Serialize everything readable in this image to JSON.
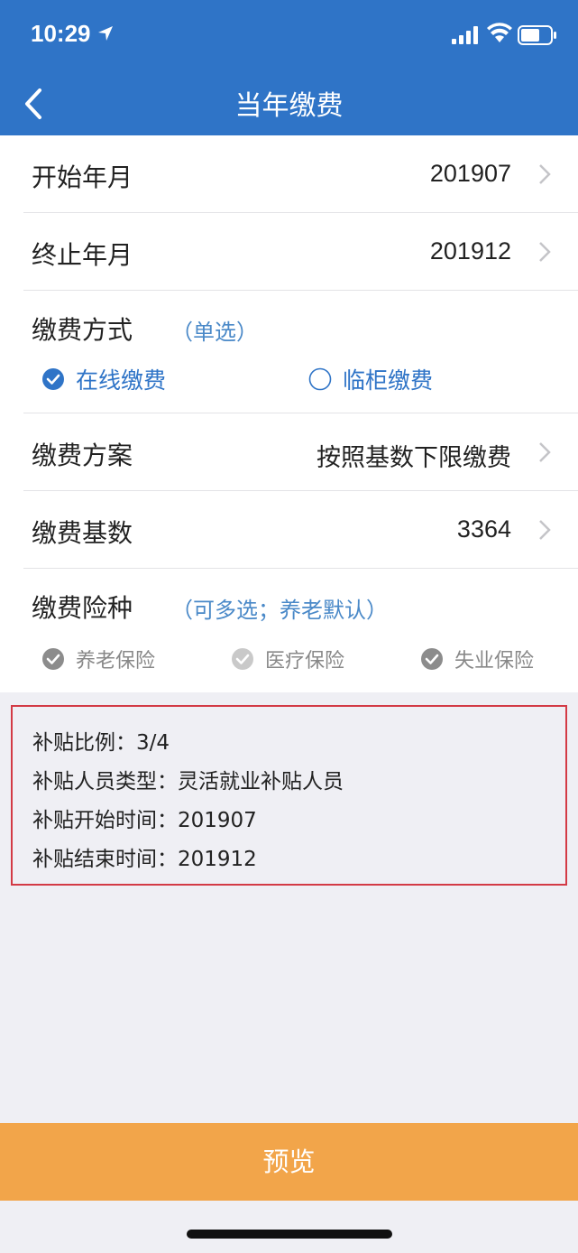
{
  "status_bar": {
    "time": "10:29"
  },
  "header": {
    "title": "当年缴费"
  },
  "form": {
    "start": {
      "label": "开始年月",
      "value": "201907"
    },
    "end": {
      "label": "终止年月",
      "value": "201912"
    },
    "payment_method": {
      "label": "缴费方式",
      "hint": "（单选）",
      "options": [
        {
          "label": "在线缴费",
          "selected": true
        },
        {
          "label": "临柜缴费",
          "selected": false
        }
      ]
    },
    "plan": {
      "label": "缴费方案",
      "value": "按照基数下限缴费"
    },
    "base": {
      "label": "缴费基数",
      "value": "3364"
    },
    "insurance": {
      "label": "缴费险种",
      "hint": "（可多选；养老默认）",
      "options": [
        {
          "label": "养老保险",
          "checked": true
        },
        {
          "label": "医疗保险",
          "checked": true
        },
        {
          "label": "失业保险",
          "checked": true
        }
      ]
    }
  },
  "subsidy": {
    "ratio": "补贴比例：3/4",
    "type": "补贴人员类型：灵活就业补贴人员",
    "start": "补贴开始时间：201907",
    "end": "补贴结束时间：201912"
  },
  "footer": {
    "preview_label": "预览"
  },
  "colors": {
    "header": "#2f74c7",
    "accent": "#4a89c8",
    "button": "#f2a54a",
    "highlight_border": "#d33a45"
  }
}
